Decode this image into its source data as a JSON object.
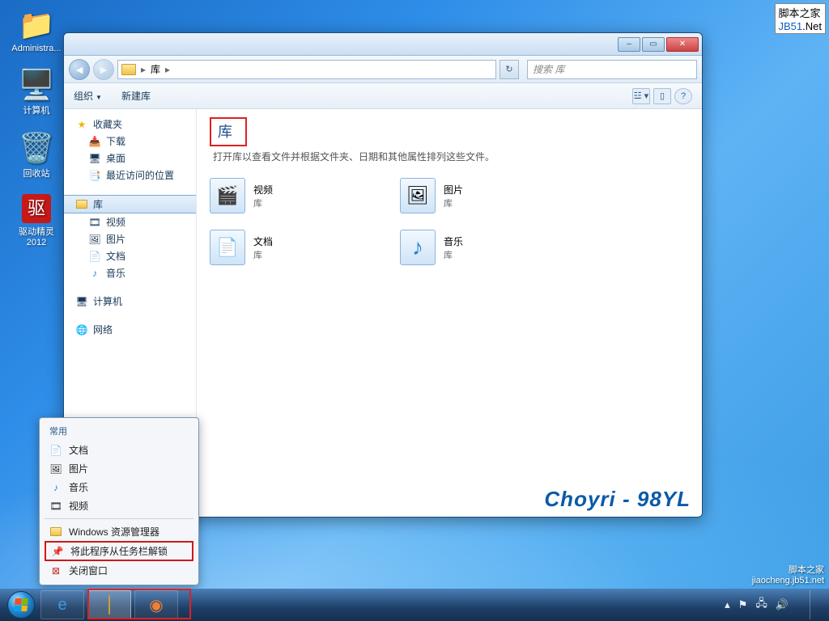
{
  "watermark_top": {
    "line1": "脚本之家",
    "line2_a": "JB51",
    "line2_b": ".Net"
  },
  "watermark_bottom": {
    "line1": "脚本之家",
    "line2": "jiaocheng.jb51.net"
  },
  "desktop": [
    {
      "label": "Administra..."
    },
    {
      "label": "计算机"
    },
    {
      "label": "回收站"
    },
    {
      "label": "驱动精灵\n2012"
    }
  ],
  "window": {
    "breadcrumb_root": "库",
    "breadcrumb_sep": "▸",
    "search_placeholder": "搜索 库",
    "toolbar": {
      "organize": "组织",
      "newlib": "新建库"
    },
    "sidebar": {
      "favorites": "收藏夹",
      "downloads": "下载",
      "desktop": "桌面",
      "recent": "最近访问的位置",
      "libraries": "库",
      "video": "视频",
      "pictures": "图片",
      "documents": "文档",
      "music": "音乐",
      "computer": "计算机",
      "network": "网络"
    },
    "content": {
      "heading": "库",
      "subtitle": "打开库以查看文件并根据文件夹、日期和其他属性排列这些文件。",
      "items": {
        "video": {
          "title": "视频",
          "sub": "库"
        },
        "pictures": {
          "title": "图片",
          "sub": "库"
        },
        "documents": {
          "title": "文档",
          "sub": "库"
        },
        "music": {
          "title": "音乐",
          "sub": "库"
        }
      }
    },
    "brand": "Choyri - 98YL"
  },
  "jumplist": {
    "recent_header": "常用",
    "documents": "文档",
    "pictures": "图片",
    "music": "音乐",
    "video": "视频",
    "explorer": "Windows 资源管理器",
    "unpin": "将此程序从任务栏解锁",
    "close": "关闭窗口"
  },
  "tray": {
    "time": ""
  }
}
